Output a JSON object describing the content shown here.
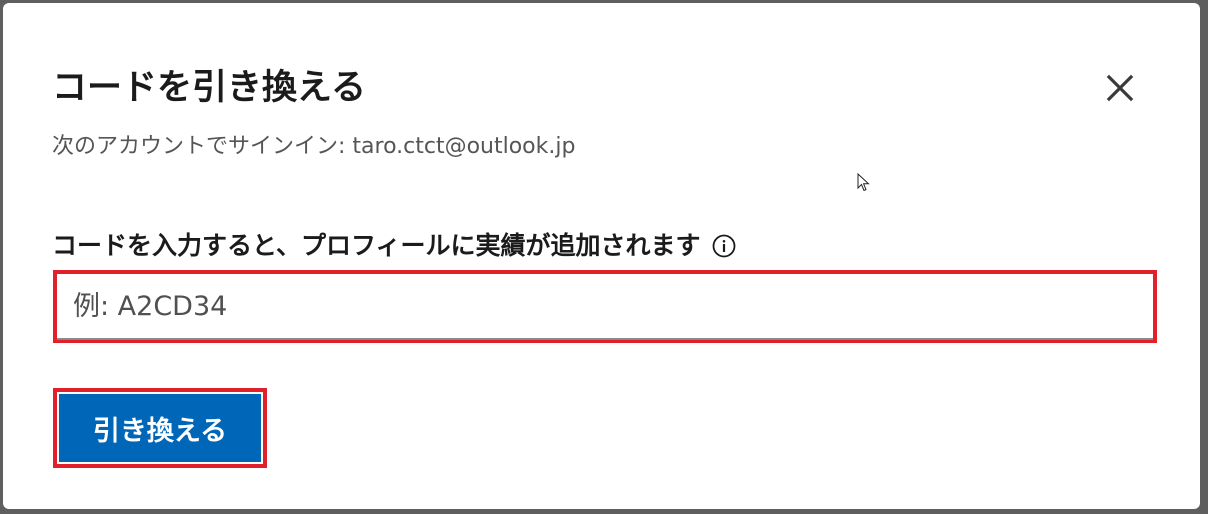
{
  "dialog": {
    "title": "コードを引き換える",
    "close_icon": "close-icon",
    "subtitle": "次のアカウントでサインイン: taro.ctct@outlook.jp",
    "field_label": "コードを入力すると、プロフィールに実績が追加されます",
    "info_icon": "info-icon",
    "code_input": {
      "value": "",
      "placeholder": "例: A2CD34"
    },
    "redeem_label": "引き換える"
  },
  "colors": {
    "accent": "#0067b8",
    "highlight": "#e0202a"
  }
}
